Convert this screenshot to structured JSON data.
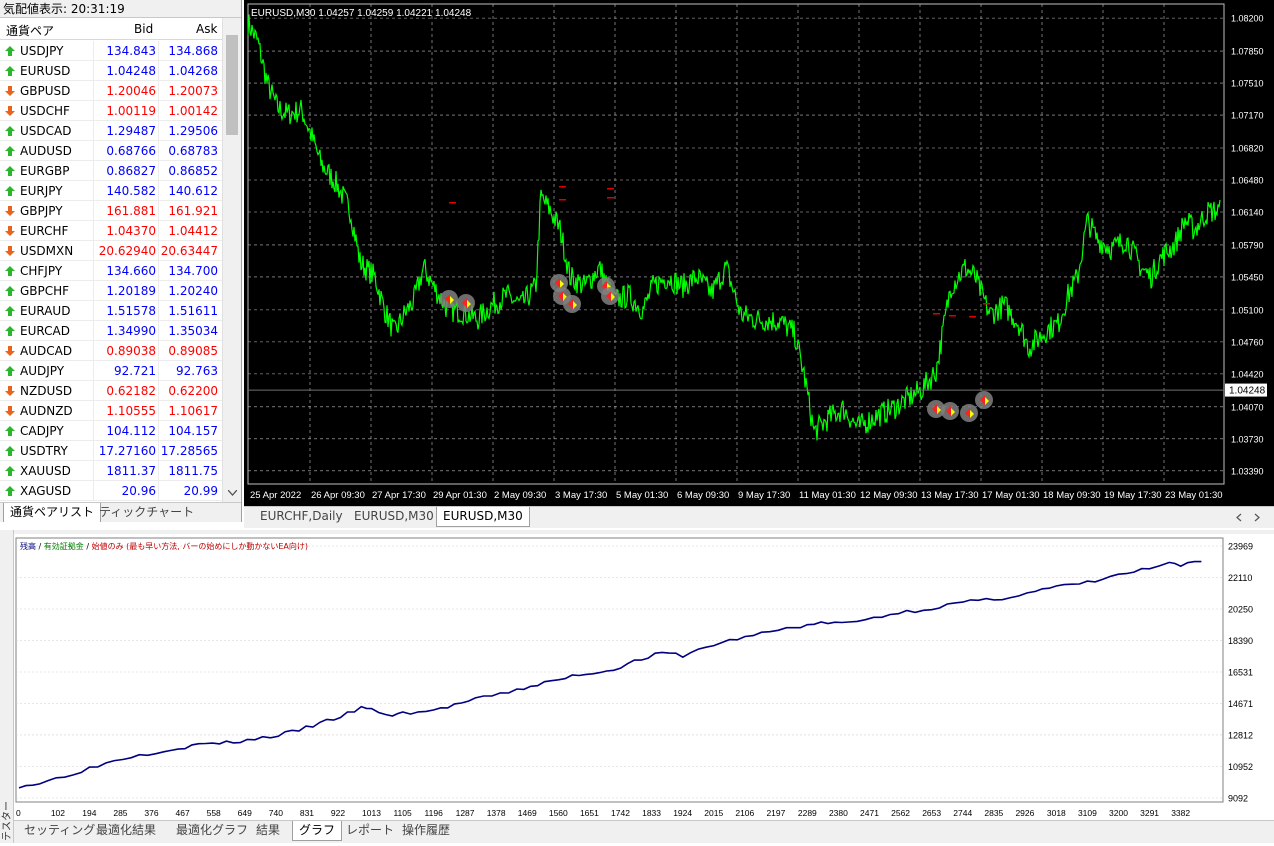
{
  "market_watch": {
    "title": "気配値表示: 20:31:19",
    "col_symbol": "通貨ペア",
    "col_bid": "Bid",
    "col_ask": "Ask",
    "rows": [
      {
        "symbol": "USDJPY",
        "bid": "134.843",
        "ask": "134.868",
        "dir": "up",
        "color": "#0000ff"
      },
      {
        "symbol": "EURUSD",
        "bid": "1.04248",
        "ask": "1.04268",
        "dir": "up",
        "color": "#0000ff"
      },
      {
        "symbol": "GBPUSD",
        "bid": "1.20046",
        "ask": "1.20073",
        "dir": "down",
        "color": "#ff0000"
      },
      {
        "symbol": "USDCHF",
        "bid": "1.00119",
        "ask": "1.00142",
        "dir": "down",
        "color": "#ff0000"
      },
      {
        "symbol": "USDCAD",
        "bid": "1.29487",
        "ask": "1.29506",
        "dir": "up",
        "color": "#0000ff"
      },
      {
        "symbol": "AUDUSD",
        "bid": "0.68766",
        "ask": "0.68783",
        "dir": "up",
        "color": "#0000ff"
      },
      {
        "symbol": "EURGBP",
        "bid": "0.86827",
        "ask": "0.86852",
        "dir": "up",
        "color": "#0000ff"
      },
      {
        "symbol": "EURJPY",
        "bid": "140.582",
        "ask": "140.612",
        "dir": "up",
        "color": "#0000ff"
      },
      {
        "symbol": "GBPJPY",
        "bid": "161.881",
        "ask": "161.921",
        "dir": "down",
        "color": "#ff0000"
      },
      {
        "symbol": "EURCHF",
        "bid": "1.04370",
        "ask": "1.04412",
        "dir": "down",
        "color": "#ff0000"
      },
      {
        "symbol": "USDMXN",
        "bid": "20.62940",
        "ask": "20.63447",
        "dir": "down",
        "color": "#ff0000"
      },
      {
        "symbol": "CHFJPY",
        "bid": "134.660",
        "ask": "134.700",
        "dir": "up",
        "color": "#0000ff"
      },
      {
        "symbol": "GBPCHF",
        "bid": "1.20189",
        "ask": "1.20240",
        "dir": "up",
        "color": "#0000ff"
      },
      {
        "symbol": "EURAUD",
        "bid": "1.51578",
        "ask": "1.51611",
        "dir": "up",
        "color": "#0000ff"
      },
      {
        "symbol": "EURCAD",
        "bid": "1.34990",
        "ask": "1.35034",
        "dir": "up",
        "color": "#0000ff"
      },
      {
        "symbol": "AUDCAD",
        "bid": "0.89038",
        "ask": "0.89085",
        "dir": "down",
        "color": "#ff0000"
      },
      {
        "symbol": "AUDJPY",
        "bid": "92.721",
        "ask": "92.763",
        "dir": "up",
        "color": "#0000ff"
      },
      {
        "symbol": "NZDUSD",
        "bid": "0.62182",
        "ask": "0.62200",
        "dir": "down",
        "color": "#ff0000"
      },
      {
        "symbol": "AUDNZD",
        "bid": "1.10555",
        "ask": "1.10617",
        "dir": "down",
        "color": "#ff0000"
      },
      {
        "symbol": "CADJPY",
        "bid": "104.112",
        "ask": "104.157",
        "dir": "up",
        "color": "#0000ff"
      },
      {
        "symbol": "USDTRY",
        "bid": "17.27160",
        "ask": "17.28565",
        "dir": "up",
        "color": "#0000ff"
      },
      {
        "symbol": "XAUUSD",
        "bid": "1811.37",
        "ask": "1811.75",
        "dir": "up",
        "color": "#0000ff"
      },
      {
        "symbol": "XAGUSD",
        "bid": "20.96",
        "ask": "20.99",
        "dir": "up",
        "color": "#0000ff"
      }
    ],
    "tab_symbols": "通貨ペアリスト",
    "tab_tick": "ティックチャート"
  },
  "price_chart": {
    "info": "EURUSD,M30  1.04257 1.04259 1.04221 1.04248",
    "current_price": "1.04248",
    "current_value": 1.04248,
    "y_min": 1.0325,
    "y_max": 1.0835,
    "y_ticks": [
      "1.08200",
      "1.07850",
      "1.07510",
      "1.07170",
      "1.06820",
      "1.06480",
      "1.06140",
      "1.05790",
      "1.05450",
      "1.05100",
      "1.04760",
      "1.04420",
      "1.04070",
      "1.03730",
      "1.03390"
    ],
    "x_ticks": [
      "25 Apr 2022",
      "26 Apr 09:30",
      "27 Apr 17:30",
      "29 Apr 01:30",
      "2 May 09:30",
      "3 May 17:30",
      "5 May 01:30",
      "6 May 09:30",
      "9 May 17:30",
      "11 May 01:30",
      "12 May 09:30",
      "13 May 17:30",
      "17 May 01:30",
      "18 May 09:30",
      "19 May 17:30",
      "23 May 01:30"
    ],
    "bg_color": "#000000",
    "line_color": "#00ff00",
    "grid_color": "#c0c0c0",
    "keypoints": [
      [
        0,
        1.0815
      ],
      [
        0.01,
        1.0795
      ],
      [
        0.02,
        1.075
      ],
      [
        0.03,
        1.0725
      ],
      [
        0.04,
        1.0718
      ],
      [
        0.055,
        1.0722
      ],
      [
        0.065,
        1.0695
      ],
      [
        0.075,
        1.0665
      ],
      [
        0.09,
        1.0645
      ],
      [
        0.105,
        1.0615
      ],
      [
        0.115,
        1.056
      ],
      [
        0.13,
        1.0545
      ],
      [
        0.14,
        1.051
      ],
      [
        0.15,
        1.0485
      ],
      [
        0.16,
        1.0505
      ],
      [
        0.17,
        1.052
      ],
      [
        0.18,
        1.0555
      ],
      [
        0.19,
        1.0535
      ],
      [
        0.205,
        1.051
      ],
      [
        0.22,
        1.0508
      ],
      [
        0.235,
        1.05
      ],
      [
        0.25,
        1.0515
      ],
      [
        0.265,
        1.0525
      ],
      [
        0.28,
        1.0515
      ],
      [
        0.295,
        1.0535
      ],
      [
        0.3,
        1.063
      ],
      [
        0.31,
        1.0615
      ],
      [
        0.32,
        1.0595
      ],
      [
        0.33,
        1.0545
      ],
      [
        0.345,
        1.0535
      ],
      [
        0.36,
        1.0555
      ],
      [
        0.375,
        1.052
      ],
      [
        0.39,
        1.0525
      ],
      [
        0.405,
        1.051
      ],
      [
        0.415,
        1.0535
      ],
      [
        0.43,
        1.0545
      ],
      [
        0.445,
        1.0535
      ],
      [
        0.46,
        1.0545
      ],
      [
        0.475,
        1.0528
      ],
      [
        0.49,
        1.0555
      ],
      [
        0.505,
        1.0505
      ],
      [
        0.52,
        1.05
      ],
      [
        0.545,
        1.0498
      ],
      [
        0.56,
        1.0485
      ],
      [
        0.57,
        1.044
      ],
      [
        0.58,
        1.038
      ],
      [
        0.595,
        1.0395
      ],
      [
        0.61,
        1.0405
      ],
      [
        0.625,
        1.0385
      ],
      [
        0.64,
        1.0395
      ],
      [
        0.66,
        1.0405
      ],
      [
        0.675,
        1.0415
      ],
      [
        0.69,
        1.0425
      ],
      [
        0.705,
        1.0445
      ],
      [
        0.72,
        1.0535
      ],
      [
        0.735,
        1.0555
      ],
      [
        0.745,
        1.0545
      ],
      [
        0.76,
        1.0505
      ],
      [
        0.775,
        1.0515
      ],
      [
        0.79,
        1.0495
      ],
      [
        0.8,
        1.047
      ],
      [
        0.81,
        1.048
      ],
      [
        0.82,
        1.049
      ],
      [
        0.83,
        1.0495
      ],
      [
        0.84,
        1.0525
      ],
      [
        0.85,
        1.0545
      ],
      [
        0.86,
        1.0605
      ],
      [
        0.87,
        1.0585
      ],
      [
        0.885,
        1.0575
      ],
      [
        0.9,
        1.0585
      ],
      [
        0.915,
        1.0555
      ],
      [
        0.925,
        1.0545
      ],
      [
        0.935,
        1.0565
      ],
      [
        0.95,
        1.058
      ],
      [
        0.96,
        1.0605
      ],
      [
        0.97,
        1.0595
      ],
      [
        0.98,
        1.061
      ],
      [
        0.985,
        1.0615
      ]
    ]
  },
  "chart_tabs": [
    "EURCHF,Daily",
    "EURUSD,M30",
    "EURUSD,M30"
  ],
  "equity_graph": {
    "legend_balance": "残高",
    "legend_equity": "有効証拠金",
    "legend_open": "始値のみ (最も早い方法, バーの始めにしか動かないEA向け)",
    "y_ticks": [
      "23969",
      "22110",
      "20250",
      "18390",
      "16531",
      "14671",
      "12812",
      "10952",
      "9092"
    ],
    "y_min": 9092,
    "y_max": 23969,
    "x_ticks": [
      "0",
      "102",
      "194",
      "285",
      "376",
      "467",
      "558",
      "649",
      "740",
      "831",
      "922",
      "1013",
      "1105",
      "1196",
      "1287",
      "1378",
      "1469",
      "1560",
      "1651",
      "1742",
      "1833",
      "1924",
      "2015",
      "2106",
      "2197",
      "2289",
      "2380",
      "2471",
      "2562",
      "2653",
      "2744",
      "2835",
      "2926",
      "3018",
      "3109",
      "3200",
      "3291",
      "3382"
    ],
    "x_max": 3440,
    "line_color": "#000080",
    "keypoints": [
      [
        0,
        9800
      ],
      [
        100,
        9950
      ],
      [
        300,
        10700
      ],
      [
        500,
        11450
      ],
      [
        700,
        11900
      ],
      [
        800,
        12100
      ],
      [
        900,
        12300
      ],
      [
        1000,
        12350
      ],
      [
        1100,
        12500
      ],
      [
        1250,
        12800
      ],
      [
        1350,
        13100
      ],
      [
        1450,
        13500
      ],
      [
        1550,
        13900
      ],
      [
        1650,
        14400
      ],
      [
        1700,
        14300
      ],
      [
        1800,
        13950
      ],
      [
        1850,
        14100
      ],
      [
        2000,
        14250
      ],
      [
        2100,
        14600
      ],
      [
        2200,
        14900
      ],
      [
        2400,
        15450
      ],
      [
        2500,
        15800
      ],
      [
        2600,
        16050
      ],
      [
        2700,
        16400
      ],
      [
        2800,
        16500
      ],
      [
        2900,
        16850
      ],
      [
        3000,
        17300
      ],
      [
        3100,
        17650
      ],
      [
        3200,
        17500
      ],
      [
        3350,
        18150
      ],
      [
        3500,
        18600
      ],
      [
        3700,
        19100
      ],
      [
        3800,
        19300
      ],
      [
        3900,
        19450
      ],
      [
        4000,
        19400
      ],
      [
        4200,
        19950
      ],
      [
        4400,
        20300
      ],
      [
        4550,
        20650
      ],
      [
        4700,
        20800
      ],
      [
        4900,
        21300
      ],
      [
        5000,
        21550
      ],
      [
        5150,
        21800
      ],
      [
        5300,
        22250
      ],
      [
        5450,
        22650
      ],
      [
        5545,
        22900
      ],
      [
        5600,
        22800
      ],
      [
        5700,
        23050
      ]
    ],
    "x_scale_max": 5780
  },
  "side_label": "テスター",
  "bottom_tabs": [
    "セッティング",
    "最適化結果",
    "最適化グラフ",
    "結果",
    "グラフ",
    "レポート",
    "操作履歴"
  ]
}
